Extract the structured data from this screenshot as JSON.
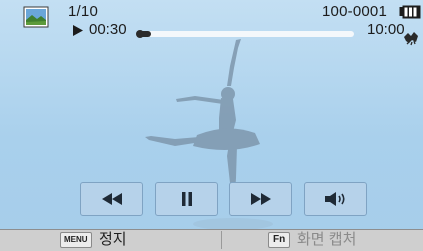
{
  "status": {
    "counter": "1/10",
    "elapsed": "00:30",
    "file_number": "100-0001",
    "duration": "10:00",
    "progress": 0.06
  },
  "icons": {
    "thumbnail": "landscape-thumbnail-icon",
    "play": "play-icon",
    "battery": "battery-full-icon",
    "stabilizer": "stabilizer-icon"
  },
  "controls": [
    {
      "name": "rewind",
      "icon": "rewind-icon"
    },
    {
      "name": "pause",
      "icon": "pause-icon"
    },
    {
      "name": "fast-forward",
      "icon": "fast-forward-icon"
    },
    {
      "name": "volume",
      "icon": "volume-icon"
    }
  ],
  "bottom_bar": {
    "menu_key": "MENU",
    "stop_label": "정지",
    "fn_key": "Fn",
    "capture_label": "화면 캡처"
  },
  "colors": {
    "screen_top": "#c3dff3",
    "screen_bottom": "#a6cdea",
    "button_fill": "#b6d2ea",
    "button_border": "#7fa3c3",
    "bottom_bar": "#cfcfcf",
    "disabled_text": "#8b8b8b"
  }
}
